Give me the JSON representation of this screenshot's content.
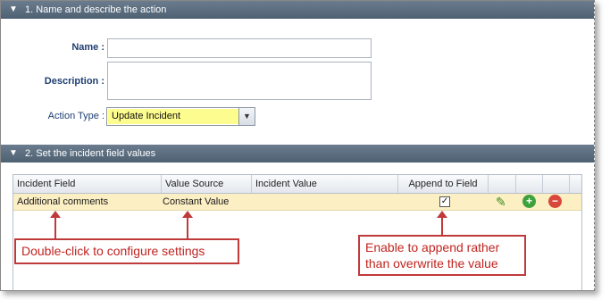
{
  "section1": {
    "chevron": "❯",
    "title": "1. Name and describe the action"
  },
  "form": {
    "name_label": "Name :",
    "name_value": "",
    "description_label": "Description :",
    "description_value": "",
    "action_type_label": "Action Type :",
    "action_type_value": "Update Incident"
  },
  "section2": {
    "chevron": "❯",
    "title": "2. Set the incident field values"
  },
  "grid": {
    "columns": [
      "Incident Field",
      "Value Source",
      "Incident Value",
      "Append to Field"
    ],
    "rows": [
      {
        "incident_field": "Additional comments",
        "value_source": "Constant Value",
        "incident_value": "",
        "append_checked": "✓"
      }
    ]
  },
  "callouts": {
    "configure": "Double-click to configure settings",
    "append": "Enable to append rather than overwrite the value"
  },
  "colors": {
    "header": "#55687a",
    "highlight": "#fdfc8e",
    "row": "#fcefc4",
    "callout": "#c03a3a"
  },
  "icons": [
    "chevron-down-icon",
    "dropdown-arrow-icon",
    "edit-pencil-icon",
    "add-icon",
    "remove-icon",
    "checkbox-checked-icon"
  ]
}
